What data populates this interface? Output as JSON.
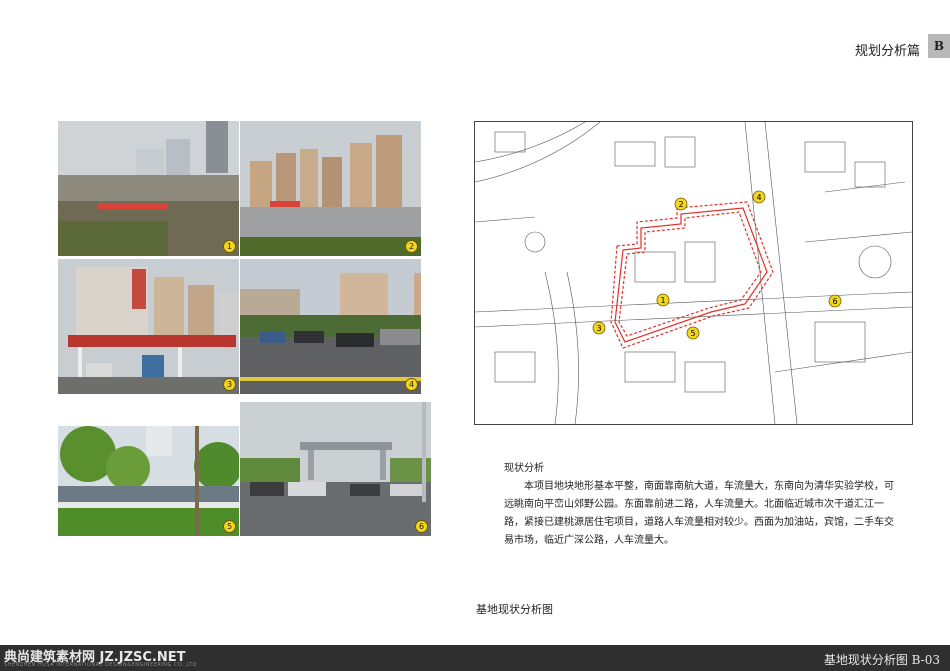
{
  "header": {
    "section_title": "规划分析篇",
    "tab_letter": "B"
  },
  "photos": [
    {
      "number": "1",
      "description": "demolition site with distant towers"
    },
    {
      "number": "2",
      "description": "residential towers behind construction wall"
    },
    {
      "number": "3",
      "description": "gas station and buildings"
    },
    {
      "number": "4",
      "description": "wet road with cars"
    },
    {
      "number": "5",
      "description": "green roadside trees"
    },
    {
      "number": "6",
      "description": "gateway with traffic"
    }
  ],
  "map": {
    "markers": [
      "1",
      "2",
      "3",
      "4",
      "5",
      "6"
    ]
  },
  "analysis": {
    "title": "现状分析",
    "body": "本项目地块地形基本平整，南面靠南航大道，车流量大，东南向为清华实验学校，可远眺南向平峦山郊野公园。东面靠前进二路，人车流量大。北面临近城市次干道汇江一路，紧接已建桃源居住宅项目，道路人车流量相对较少。西面为加油站，宾馆，二手车交易市场，临近广深公路，人车流量大。"
  },
  "caption": "基地现状分析图",
  "footer": {
    "watermark": "典尚建筑素材网 JZ.JZSC.NET",
    "company": "SHENZHEN HUSA INTERNATIONAL DESIGN&ENGINEERING CO.,LTD",
    "page_label": "基地现状分析图 B-03"
  }
}
